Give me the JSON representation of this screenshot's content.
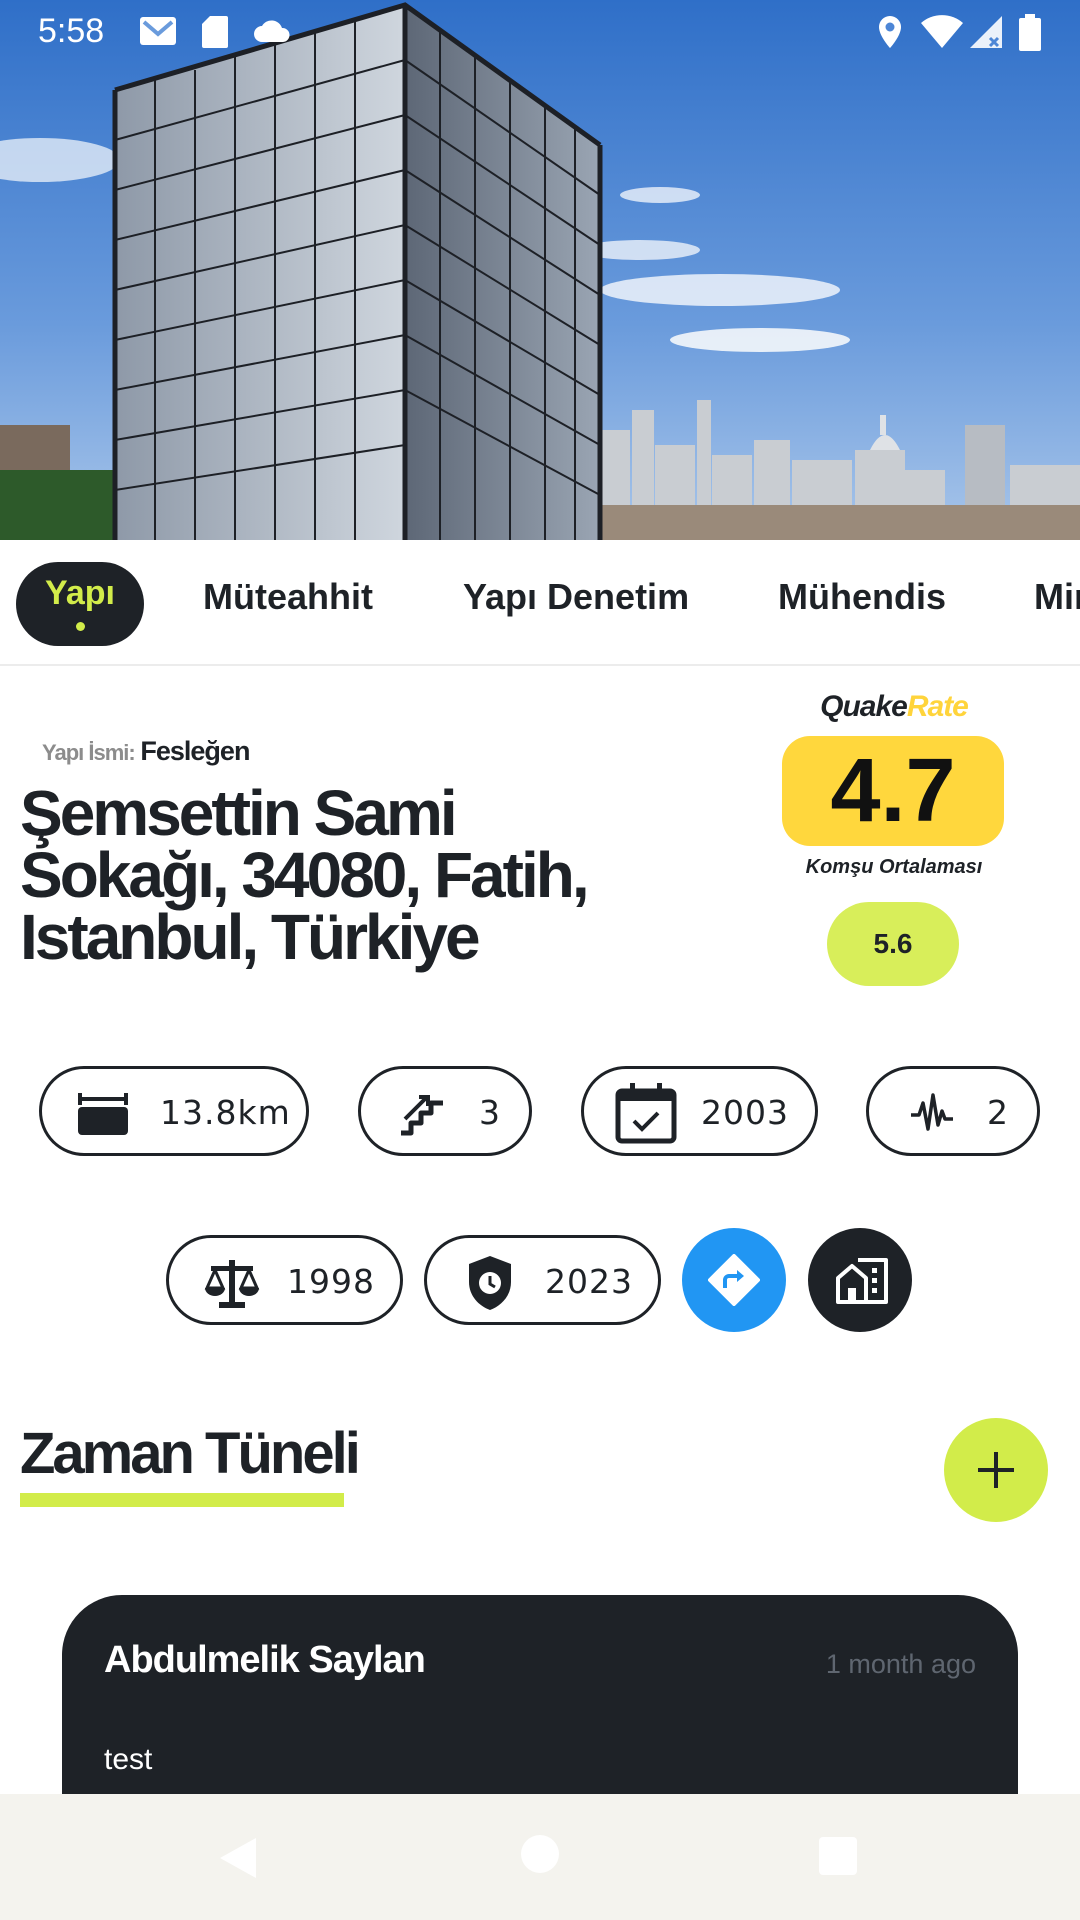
{
  "status_bar": {
    "time": "5:58",
    "left_icons": [
      "gmail-icon",
      "sd-card-icon",
      "cloud-icon"
    ],
    "right_icons": [
      "location-icon",
      "wifi-icon",
      "signal-icon",
      "battery-icon"
    ]
  },
  "hero": {
    "image_description_icon": "building-photo"
  },
  "tabs": [
    {
      "label": "Yapı",
      "active": true
    },
    {
      "label": "Müteahhit",
      "active": false
    },
    {
      "label": "Yapı Denetim",
      "active": false
    },
    {
      "label": "Mühendis",
      "active": false
    },
    {
      "label": "Mimar",
      "active": false
    }
  ],
  "building": {
    "name_label": "Yapı İsmi:",
    "name": "Fesleğen",
    "address": "Şemsettin Sami Sokağı, 34080, Fatih, Istanbul, Türkiye"
  },
  "rating": {
    "brand_part1": "Quake",
    "brand_part2": "Rate",
    "score": "4.7",
    "neighbor_label": "Komşu Ortalaması",
    "neighbor_score": "5.6"
  },
  "stats": {
    "distance": {
      "icon": "fault-line-icon",
      "value": "13.8km"
    },
    "floors": {
      "icon": "stairs-icon",
      "value": "3"
    },
    "year_built": {
      "icon": "calendar-icon",
      "value": "2003"
    },
    "earthquakes": {
      "icon": "seismic-wave-icon",
      "value": "2"
    },
    "regulation_year": {
      "icon": "scale-icon",
      "value": "1998"
    },
    "inspection_year": {
      "icon": "shield-clock-icon",
      "value": "2023"
    }
  },
  "actions": {
    "directions_icon": "directions-icon",
    "buildings_icon": "buildings-icon",
    "add_icon": "plus-icon"
  },
  "timeline": {
    "title": "Zaman Tüneli",
    "posts": [
      {
        "author": "Abdulmelik Saylan",
        "time": "1 month ago",
        "body": "test"
      }
    ]
  },
  "colors": {
    "dark": "#1e2227",
    "lime": "#d2ec4a",
    "yellow": "#ffd73d",
    "blue": "#2196f3"
  },
  "nav_bar": {
    "icons": [
      "back-icon",
      "home-icon",
      "recents-icon"
    ]
  }
}
